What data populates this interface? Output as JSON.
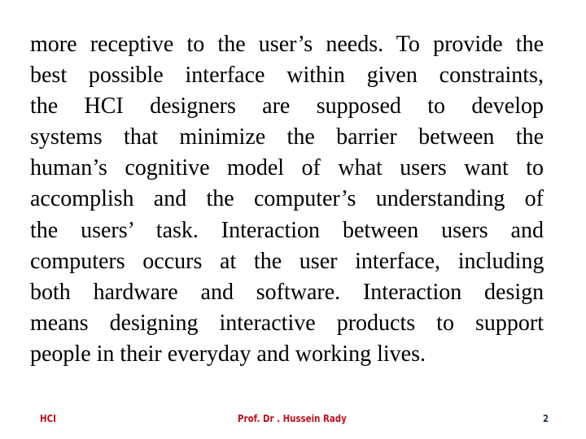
{
  "slide": {
    "body_lines": [
      "more receptive to the user’s needs. To provide the",
      "best possible interface within given constraints,",
      "the HCI designers are supposed to develop",
      "systems that minimize the barrier between the",
      "human’s cognitive model of what users want to",
      "accomplish and the computer’s understanding of",
      "the users’ task. Interaction between users and",
      "computers occurs at the user interface, including",
      "both hardware and software. Interaction design",
      "means designing interactive products to support",
      "people in their everyday and working lives."
    ],
    "footer": {
      "left_label": "HCI",
      "center_label": "Prof.  Dr . Hussein Rady",
      "page_number": "2"
    },
    "colors": {
      "footer_accent": "#c0111f",
      "page_number": "#2b3a4a",
      "body_text": "#000000"
    }
  }
}
